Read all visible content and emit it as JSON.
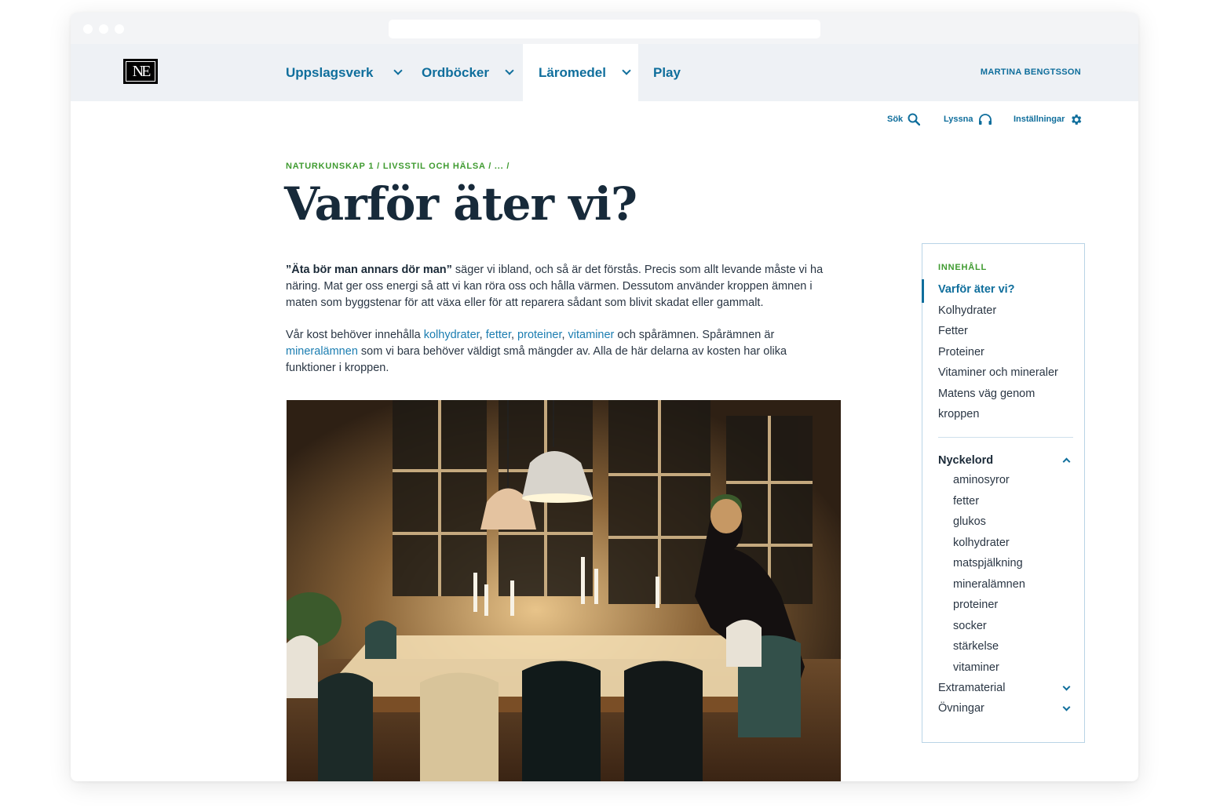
{
  "nav": {
    "logo": "NE",
    "items": [
      {
        "label": "Uppslagsverk"
      },
      {
        "label": "Ordböcker"
      },
      {
        "label": "Läromedel"
      },
      {
        "label": "Play"
      }
    ],
    "user": "MARTINA BENGTSSON"
  },
  "tools": {
    "search": "Sök",
    "listen": "Lyssna",
    "settings": "Inställningar"
  },
  "article": {
    "breadcrumb": "NATURKUNSKAP 1 / LIVSSTIL OCH HÄLSA / ... /",
    "title": "Varför äter vi?",
    "p1_bold": "”Äta bör man annars dör man”",
    "p1_rest": " säger vi ibland, och så är det förstås. Precis som allt levande måste vi ha näring. Mat ger oss energi så att vi kan röra oss och hålla värmen. Dessutom använder kroppen ämnen i maten som byggstenar för att växa eller för att reparera sådant som blivit skadat eller gammalt.",
    "p2_a": "Vår kost behöver innehålla ",
    "p2_link1": "kolhydrater",
    "p2_sep1": ", ",
    "p2_link2": "fetter",
    "p2_sep2": ", ",
    "p2_link3": "proteiner",
    "p2_sep3": ", ",
    "p2_link4": "vitaminer",
    "p2_b": " och spårämnen. Spårämnen är ",
    "p2_link5": "mineralämnen",
    "p2_c": " som vi bara behöver väldigt små mängder av. Alla de här delarna av kosten har olika funktioner i kroppen."
  },
  "toc": {
    "heading": "INNEHÅLL",
    "items": [
      {
        "label": "Varför äter vi?"
      },
      {
        "label": "Kolhydrater"
      },
      {
        "label": "Fetter"
      },
      {
        "label": "Proteiner"
      },
      {
        "label": "Vitaminer och mineraler"
      },
      {
        "label": "Matens väg genom"
      },
      {
        "label": "kroppen"
      }
    ],
    "keywords_heading": "Nyckelord",
    "keywords": [
      "aminosyror",
      "fetter",
      "glukos",
      "kolhydrater",
      "matspjälkning",
      "mineralämnen",
      "proteiner",
      "socker",
      "stärkelse",
      "vitaminer"
    ],
    "extramaterial": "Extramaterial",
    "exercises": "Övningar"
  },
  "colors": {
    "accent": "#0f6e9c",
    "green": "#3f9b30",
    "nav_bg": "#eef1f5",
    "title": "#172a3a"
  }
}
